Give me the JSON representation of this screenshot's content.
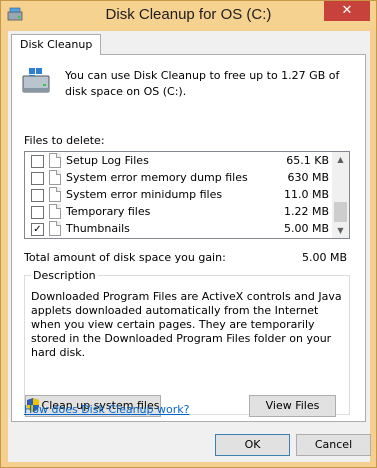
{
  "window": {
    "title": "Disk Cleanup for OS (C:)",
    "close_glyph": "✕"
  },
  "tab": {
    "label": "Disk Cleanup"
  },
  "intro_text": "You can use Disk Cleanup to free up to 1.27 GB of disk space on OS (C:).",
  "files_label": "Files to delete:",
  "files": [
    {
      "name": "Setup Log Files",
      "size": "65.1 KB",
      "checked": false
    },
    {
      "name": "System error memory dump files",
      "size": "630 MB",
      "checked": false
    },
    {
      "name": "System error minidump files",
      "size": "11.0 MB",
      "checked": false
    },
    {
      "name": "Temporary files",
      "size": "1.22 MB",
      "checked": false
    },
    {
      "name": "Thumbnails",
      "size": "5.00 MB",
      "checked": true
    }
  ],
  "total": {
    "label": "Total amount of disk space you gain:",
    "value": "5.00 MB"
  },
  "description": {
    "legend": "Description",
    "text": "Downloaded Program Files are ActiveX controls and Java applets downloaded automatically from the Internet when you view certain pages. They are temporarily stored in the Downloaded Program Files folder on your hard disk."
  },
  "buttons": {
    "cleanup_system": "Clean up system files",
    "view_files": "View Files",
    "ok": "OK",
    "cancel": "Cancel"
  },
  "help_link": "How does Disk Cleanup work?",
  "icons": {
    "app": "disk-cleanup-icon",
    "drive": "drive-icon",
    "shield": "uac-shield-icon",
    "check": "✓"
  },
  "colors": {
    "title_bar": "#f6d290",
    "close_button": "#c7423a",
    "link": "#0066cc"
  }
}
